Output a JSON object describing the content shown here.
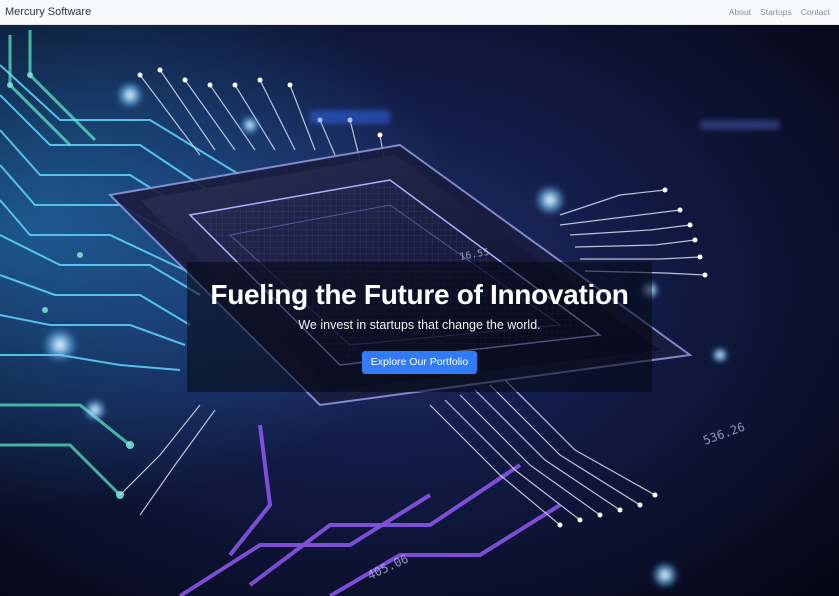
{
  "nav": {
    "brand": "Mercury Software",
    "links": [
      "About",
      "Startups",
      "Contact"
    ]
  },
  "hero": {
    "title": "Fueling the Future of Innovation",
    "subtitle": "We invest in startups that change the world.",
    "cta_label": "Explore Our Portfolio",
    "background_image": "glowing circuit board microchip",
    "chip_markings": [
      "16.55",
      "536.26",
      "405.06"
    ]
  },
  "colors": {
    "accent": "#2f7cf6",
    "navbar_bg": "#f8f9fa",
    "hero_bg": "#07091c",
    "trace_cyan": "#5fd8ff",
    "trace_teal": "#5ff0c8",
    "trace_violet": "#9b5cff"
  }
}
